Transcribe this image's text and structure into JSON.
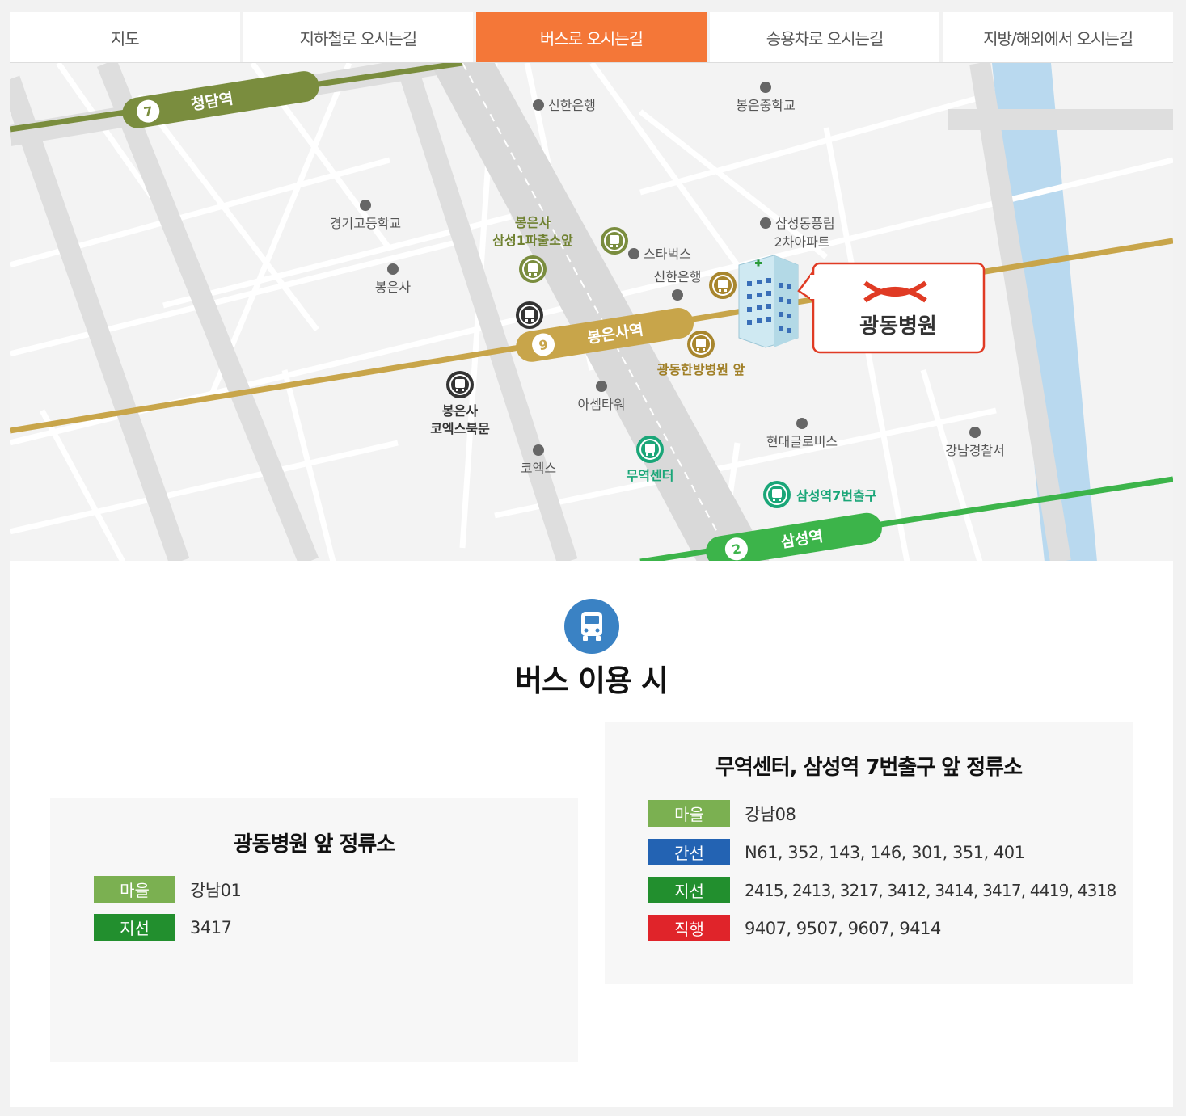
{
  "tabs": [
    {
      "label": "지도"
    },
    {
      "label": "지하철로 오시는길"
    },
    {
      "label": "버스로 오시는길",
      "active": true
    },
    {
      "label": "승용차로 오시는길"
    },
    {
      "label": "지방/해외에서 오시는길"
    }
  ],
  "map": {
    "stations": {
      "line7": {
        "num": "7",
        "name": "청담역"
      },
      "line9": {
        "num": "9",
        "name": "봉은사역"
      },
      "line2": {
        "num": "2",
        "name": "삼성역"
      }
    },
    "places": {
      "shinhan1": "신한은행",
      "bongeun_middle": "봉은중학교",
      "gyeonggi_high": "경기고등학교",
      "samsung_apt_1": "삼성동풍림",
      "samsung_apt_2": "2차아파트",
      "starbucks": "스타벅스",
      "shinhan2": "신한은행",
      "bongeunsa": "봉은사",
      "asem": "아셈타워",
      "hyundai": "현대글로비스",
      "gangnam_police": "강남경찰서",
      "coex": "코엑스"
    },
    "bus_stops": {
      "bongeunsa_police_1": "봉은사",
      "bongeunsa_police_2": "삼성1파출소앞",
      "kwangdong_oriental": "광동한방병원 앞",
      "coex_north_1": "봉은사",
      "coex_north_2": "코엑스북문",
      "trade_center": "무역센터",
      "samsung_exit7": "삼성역7번출구"
    },
    "hospital_name": "광동병원"
  },
  "section": {
    "title": "버스 이용 시",
    "icon": "bus-icon"
  },
  "cards": [
    {
      "title": "광동병원 앞 정류소",
      "rows": [
        {
          "type": "마을",
          "color": "#7bb051",
          "routes": "강남01"
        },
        {
          "type": "지선",
          "color": "#228f2e",
          "routes": "3417"
        }
      ]
    },
    {
      "title": "무역센터, 삼성역 7번출구 앞 정류소",
      "rows": [
        {
          "type": "마을",
          "color": "#7bb051",
          "routes": "강남08"
        },
        {
          "type": "간선",
          "color": "#2363b3",
          "routes": "N61, 352, 143, 146, 301, 351, 401"
        },
        {
          "type": "지선",
          "color": "#228f2e",
          "routes": "2415, 2413, 3217, 3412, 3414, 3417, 4419, 4318"
        },
        {
          "type": "직행",
          "color": "#e0242a",
          "routes": "9407, 9507, 9607, 9414"
        }
      ]
    }
  ],
  "colors": {
    "accent": "#f47738",
    "line7": "#7a8d3e",
    "line9": "#c8a54a",
    "line2": "#3cb44a",
    "river": "#b9d9ef",
    "bus_icon": "#3a82c4"
  }
}
